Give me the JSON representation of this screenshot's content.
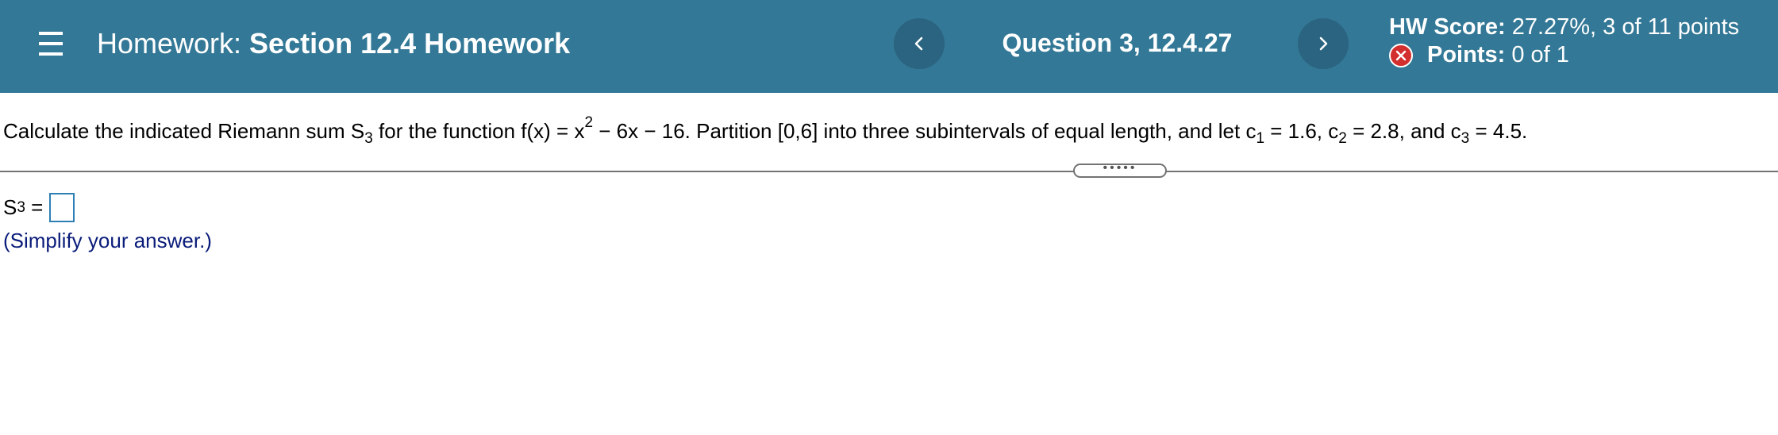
{
  "header": {
    "menu_icon": "hamburger-menu-icon",
    "title_prefix": "Homework:",
    "title_name": "Section 12.4 Homework",
    "prev_icon": "chevron-left-icon",
    "next_icon": "chevron-right-icon",
    "question_label": "Question 3, 12.4.27",
    "score_label": "HW Score:",
    "score_value": "27.27%, 3 of 11 points",
    "points_label": "Points:",
    "points_value": "0 of 1",
    "points_status_icon": "x-circle-icon",
    "colors": {
      "bar": "#337896",
      "nav_button": "#2b6480",
      "incorrect": "#d32f2f"
    }
  },
  "problem": {
    "t1": "Calculate the indicated Riemann sum S",
    "s1": "3",
    "t2": " for the function f(x) = x",
    "s2": "2",
    "t3": " − 6x − 16. Partition [0,6] into three subintervals of equal length, and let c",
    "s3": "1",
    "t4": " = 1.6, c",
    "s4": "2",
    "t5": " = 2.8, and c",
    "s5": "3",
    "t6": " = 4.5."
  },
  "expander": {
    "label": "•••••"
  },
  "answer": {
    "var": "S",
    "var_sub": "3",
    "eq": "=",
    "value": "",
    "hint": "(Simplify your answer.)",
    "box_color": "#2e7fb4"
  }
}
